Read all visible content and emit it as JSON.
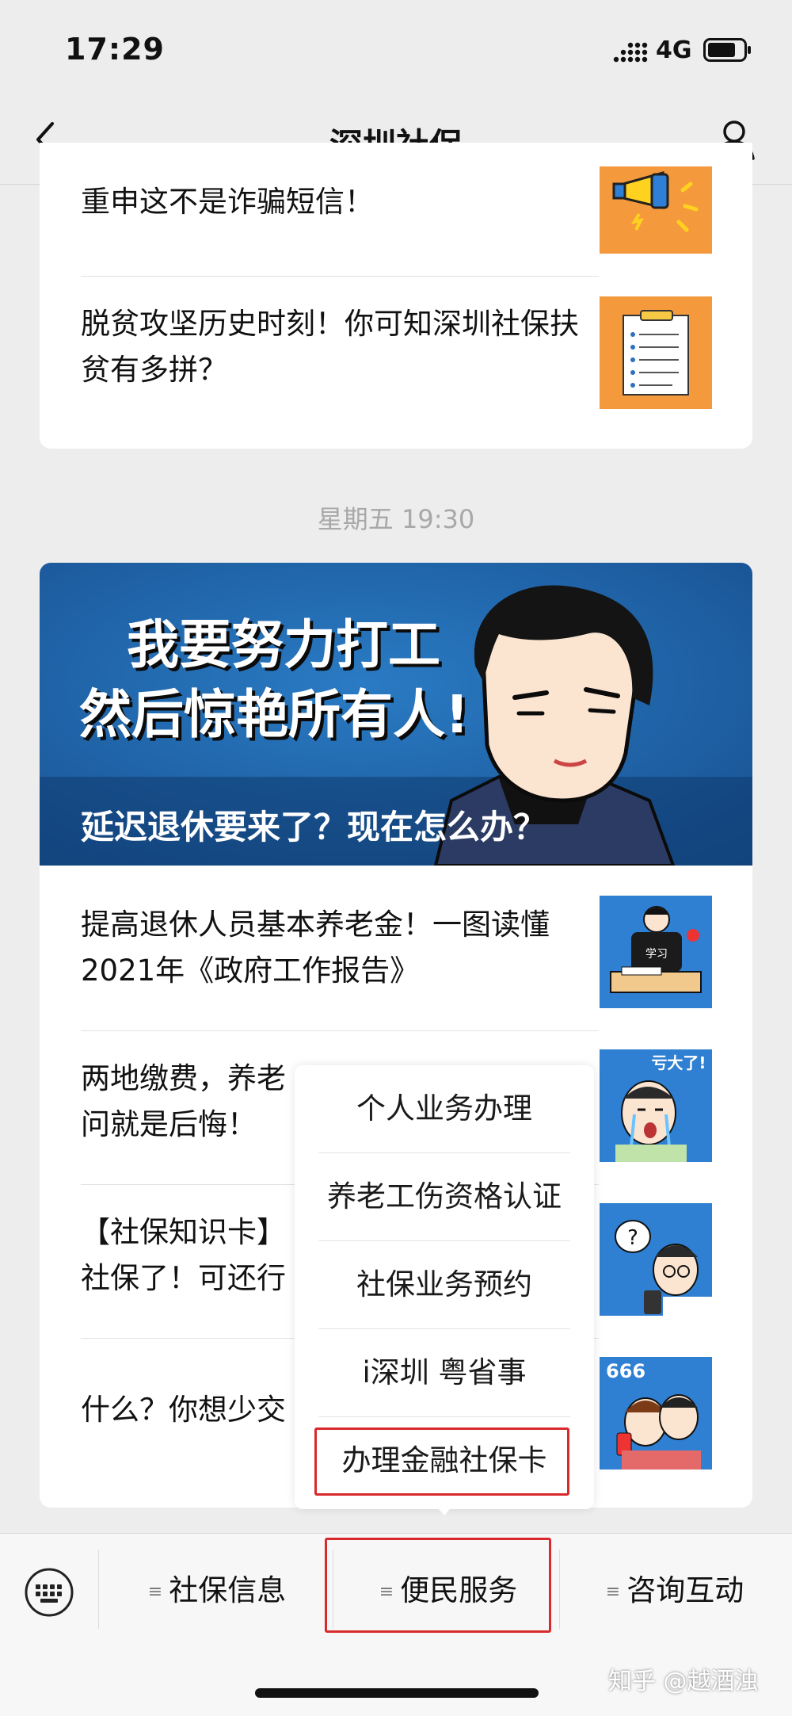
{
  "status_bar": {
    "time": "17:29",
    "network": "4G"
  },
  "nav": {
    "title": "深圳社保"
  },
  "feed": {
    "items_top": [
      {
        "title": "重申这不是诈骗短信！"
      },
      {
        "title": "脱贫攻坚历史时刻！你可知深圳社保扶贫有多拼？"
      }
    ],
    "timestamp": "星期五 19:30",
    "banner": {
      "image_text_line1": "我要努力打工",
      "image_text_line2": "然后惊艳所有人!",
      "caption": "延迟退休要来了？现在怎么办？"
    },
    "items": [
      {
        "title": "提高退休人员基本养老金！一图读懂2021年《政府工作报告》"
      },
      {
        "title_line1": "两地缴费，养老",
        "title_line2": "问就是后悔！",
        "thumb_text": "亏大了!"
      },
      {
        "title_line1": "【社保知识卡】",
        "title_line2": "社保了！可还行"
      },
      {
        "title": "什么？你想少交",
        "thumb_text": "666"
      }
    ]
  },
  "popup_menu": {
    "items": [
      "个人业务办理",
      "养老工伤资格认证",
      "社保业务预约",
      "i深圳 粤省事",
      "办理金融社保卡"
    ],
    "highlighted_index": 4
  },
  "bottom_menu": {
    "tabs": [
      "社保信息",
      "便民服务",
      "咨询互动"
    ],
    "active_tab": "便民服务"
  },
  "watermark": "知乎 @越酒浊",
  "colors": {
    "highlight_red": "#d8292c",
    "banner_blue": "#1e62a8"
  }
}
